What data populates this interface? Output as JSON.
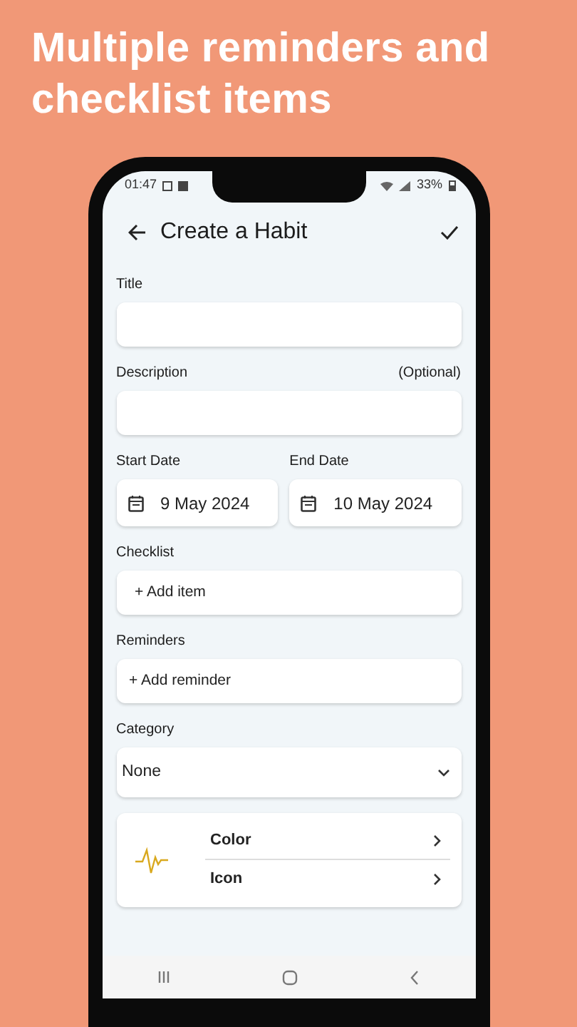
{
  "headline": "Multiple reminders and checklist items",
  "status_bar": {
    "time": "01:47",
    "battery": "33%"
  },
  "app_bar": {
    "title": "Create a Habit"
  },
  "fields": [
    {
      "label": "Title"
    },
    {
      "label": "Description",
      "hint": "(Optional)"
    }
  ],
  "dates": [
    {
      "label": "Start Date",
      "value": "9 May 2024"
    },
    {
      "label": "End Date",
      "value": "10 May 2024"
    }
  ],
  "lists": [
    {
      "label": "Checklist",
      "action": "+ Add item"
    },
    {
      "label": "Reminders",
      "action": "+ Add reminder"
    }
  ],
  "category": {
    "label": "Category",
    "value": "None"
  },
  "appearance": [
    {
      "label": "Color"
    },
    {
      "label": "Icon"
    }
  ]
}
